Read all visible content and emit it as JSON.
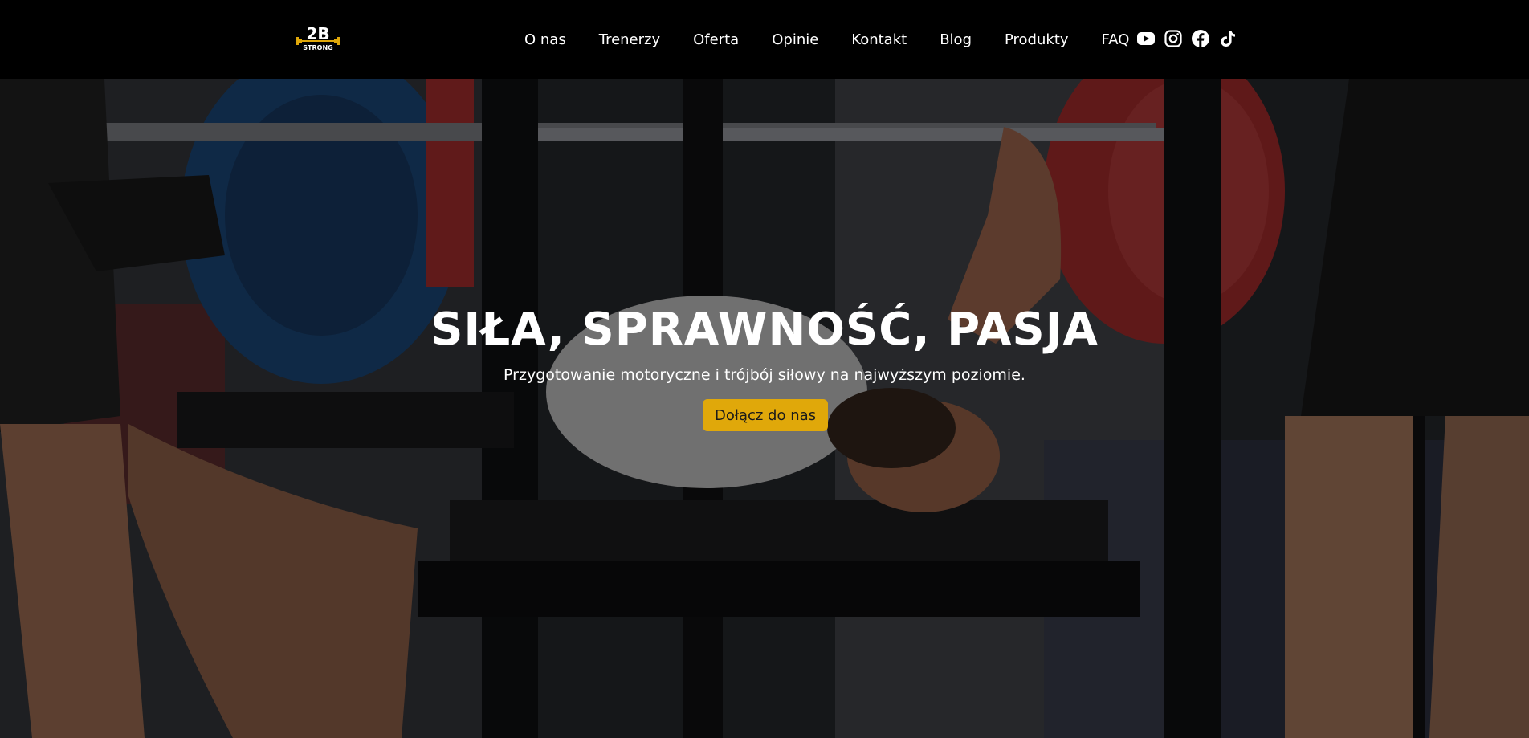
{
  "brand": {
    "logo_text": "2B",
    "logo_subtext": "STRONG",
    "accent_color": "#e0a80a"
  },
  "nav": {
    "items": [
      {
        "label": "O nas"
      },
      {
        "label": "Trenerzy"
      },
      {
        "label": "Oferta"
      },
      {
        "label": "Opinie"
      },
      {
        "label": "Kontakt"
      },
      {
        "label": "Blog"
      },
      {
        "label": "Produkty"
      },
      {
        "label": "FAQ"
      }
    ]
  },
  "socials": [
    {
      "icon": "youtube-icon"
    },
    {
      "icon": "instagram-icon"
    },
    {
      "icon": "facebook-icon"
    },
    {
      "icon": "tiktok-icon"
    }
  ],
  "hero": {
    "title": "SIŁA, SPRAWNOŚĆ, PASJA",
    "subtitle": "Przygotowanie motoryczne i trójbój siłowy na najwyższym poziomie.",
    "cta_label": "Dołącz do nas",
    "background": "powerlifter-bench-press-photo"
  }
}
